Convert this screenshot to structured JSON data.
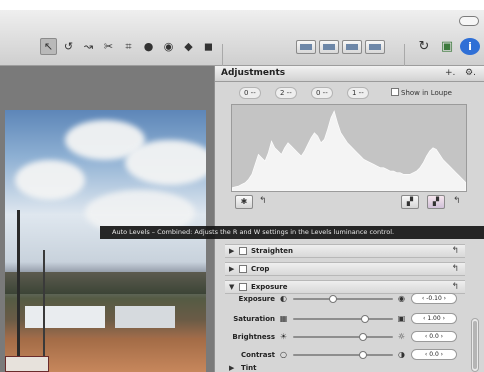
{
  "toolbar": {
    "tools": [
      {
        "icon": "pointer-icon",
        "glyph": "↖",
        "selected": true
      },
      {
        "icon": "rotate-icon",
        "glyph": "↺"
      },
      {
        "icon": "straighten-icon",
        "glyph": "↝"
      },
      {
        "icon": "transform-icon",
        "glyph": "✂"
      },
      {
        "icon": "crop-icon",
        "glyph": "⌗"
      },
      {
        "icon": "redeye-icon",
        "glyph": "●"
      },
      {
        "icon": "spot-icon",
        "glyph": "◉"
      },
      {
        "icon": "lift-icon",
        "glyph": "◆"
      },
      {
        "icon": "stamp-icon",
        "glyph": "◼"
      }
    ],
    "views": [
      "view-filmstrip-icon",
      "view-split-icon",
      "view-browser-icon",
      "view-viewer-icon"
    ],
    "right_icons": [
      {
        "icon": "rotate-right-icon",
        "glyph": "↻"
      },
      {
        "icon": "photo-icon",
        "glyph": "▣"
      },
      {
        "icon": "info-icon",
        "glyph": "i"
      }
    ]
  },
  "panel": {
    "title": "Adjustments",
    "channels": [
      "0 --",
      "2 --",
      "0 --",
      "1 --"
    ],
    "show_in_loupe": "Show in Loupe",
    "histogram": [
      4,
      5,
      6,
      8,
      10,
      14,
      20,
      32,
      44,
      40,
      36,
      46,
      60,
      52,
      48,
      44,
      52,
      58,
      54,
      50,
      46,
      42,
      48,
      56,
      64,
      70,
      66,
      58,
      62,
      74,
      88,
      96,
      82,
      70,
      64,
      58,
      54,
      50,
      46,
      42,
      38,
      36,
      34,
      32,
      30,
      28,
      28,
      26,
      24,
      24,
      22,
      22,
      20,
      20,
      20,
      22,
      24,
      28,
      34,
      42,
      48,
      52,
      50,
      44,
      38,
      34,
      30,
      26,
      22,
      18,
      14,
      10
    ]
  },
  "tooltip": "Auto Levels – Combined: Adjusts the R and W settings in the Levels luminance control.",
  "sections": [
    {
      "label": "Straighten",
      "expanded": false
    },
    {
      "label": "Crop",
      "expanded": false
    },
    {
      "label": "Exposure",
      "expanded": true
    }
  ],
  "sliders": [
    {
      "name": "Exposure",
      "value": "-0.10",
      "position": 0.4
    },
    {
      "name": "Saturation",
      "value": "1.00",
      "position": 0.72
    },
    {
      "name": "Brightness",
      "value": "0.0",
      "position": 0.7
    },
    {
      "name": "Contrast",
      "value": "0.0",
      "position": 0.7
    }
  ],
  "tint": {
    "label": "Tint"
  }
}
